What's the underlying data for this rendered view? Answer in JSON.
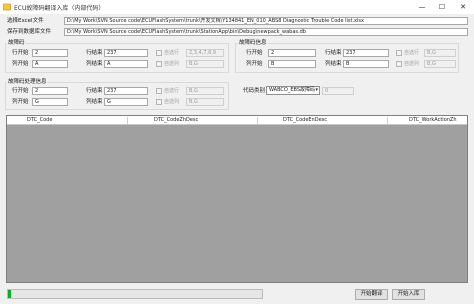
{
  "window": {
    "title": "ECU故障码翻译入库（内部代码）",
    "minimize_glyph": "—",
    "maximize_glyph": "☐",
    "close_glyph": "✕"
  },
  "paths": {
    "excel_label": "选择Excel文件",
    "excel_value": "D:\\My Work\\SVN Source code\\ECUFlashSystem\\trunk\\开发文档\\Y134841_EN_010_ABS8 Diagnostic Trouble Code list.xlsx",
    "db_label": "保存到数据库文件",
    "db_value": "D:\\My Work\\SVN Source code\\ECUFlashSystem\\trunk\\StationApp\\bin\\Debug\\newpack_wabas.db"
  },
  "group_dtc": {
    "title": "故障码",
    "row_start_label": "行开始",
    "row_start_value": "2",
    "row_end_label": "行结束",
    "row_end_value": "237",
    "auto_select_label": "自选行",
    "auto_select_value": "2,3,4,7,8,9",
    "col_start_label": "列开始",
    "col_start_value": "A",
    "col_end_label": "列结束",
    "col_end_value": "A",
    "auto_col_label": "自选列",
    "auto_col_value": "B,G"
  },
  "group_info": {
    "title": "故障码信息",
    "row_start_label": "行开始",
    "row_start_value": "2",
    "row_end_label": "行结束",
    "row_end_value": "237",
    "auto_select_label": "自选行",
    "auto_select_value": "B,G",
    "col_start_label": "列开始",
    "col_start_value": "B",
    "col_end_label": "列结束",
    "col_end_value": "B",
    "auto_col_label": "自选列",
    "auto_col_value": "B,G"
  },
  "group_action": {
    "title": "故障码处理信息",
    "row_start_label": "行开始",
    "row_start_value": "2",
    "row_end_label": "行结束",
    "row_end_value": "237",
    "auto_select_label": "自选行",
    "auto_select_value": "B,G",
    "col_start_label": "列开始",
    "col_start_value": "G",
    "col_end_label": "列结束",
    "col_end_value": "G",
    "auto_col_label": "自选列",
    "auto_col_value": "B,G"
  },
  "code_type": {
    "label": "代码类别",
    "selected": "WABCO_EBS故障码",
    "extra_value": "0"
  },
  "grid": {
    "columns": [
      "DTC_Code",
      "DTC_CodeZhDesc",
      "DTC_CodeEnDesc",
      "DTC_WorkActionZh"
    ]
  },
  "progress": {
    "percent": 1
  },
  "buttons": {
    "translate": "开始翻译",
    "import": "开始入库"
  },
  "colors": {
    "progress_fill": "#06b025",
    "grid_background": "#a0a0a0"
  }
}
